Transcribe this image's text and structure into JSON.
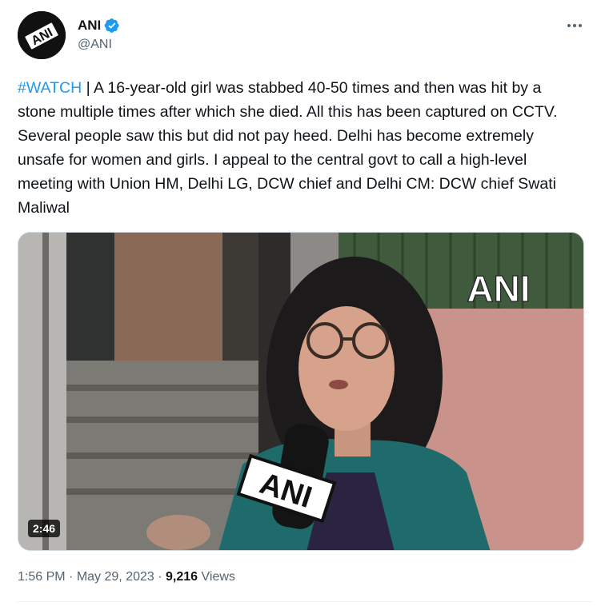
{
  "author": {
    "name": "ANI",
    "handle": "@ANI",
    "avatar_logo_text": "ANI"
  },
  "tweet": {
    "hashtag": "#WATCH",
    "body": " | A 16-year-old girl was stabbed 40-50 times and then was hit by a stone multiple times after which she died. All this has been captured on CCTV. Several people saw this but did not pay heed. Delhi has become extremely unsafe for women and girls. I appeal to the central govt to call a high-level meeting with Union HM, Delhi LG, DCW chief and Delhi CM: DCW chief Swati Maliwal"
  },
  "media": {
    "type": "video",
    "watermark": "ANI",
    "mic_logo": "ANI",
    "duration": "2:46"
  },
  "meta": {
    "time": "1:56 PM",
    "separator": "·",
    "date": "May 29, 2023",
    "views_count": "9,216",
    "views_label": "Views"
  },
  "icons": {
    "verified": "verified-badge-icon",
    "more": "more-options-icon"
  },
  "colors": {
    "accent": "#1d9bf0",
    "text": "#0f1419",
    "muted": "#536471"
  }
}
